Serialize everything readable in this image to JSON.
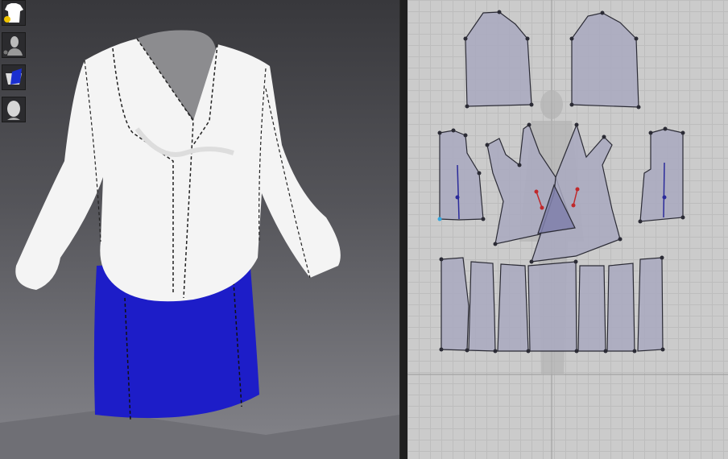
{
  "toolbar": {
    "tools": [
      {
        "icon": "garment-icon"
      },
      {
        "icon": "avatar-body-icon"
      },
      {
        "icon": "texture-icon"
      },
      {
        "icon": "avatar-head-icon"
      }
    ]
  },
  "colors": {
    "blouse": "#f4f4f4",
    "skirt": "#1d1dc8",
    "pattern_fill": "#a9a9bf",
    "pattern_stroke": "#2b2b35",
    "background_2d": "#cbcbcb",
    "notch_red": "#c0282a",
    "notch_blue": "#2a2a9a"
  }
}
